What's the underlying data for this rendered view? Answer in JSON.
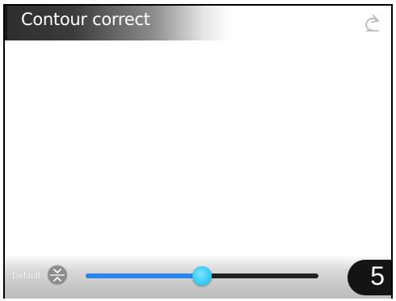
{
  "header": {
    "title": "Contour correct",
    "back_icon": "back-arrow-icon"
  },
  "footer": {
    "default_label": "Default",
    "reset_icon": "up-down-chevrons-icon",
    "slider": {
      "value": 5,
      "fill_fraction": 0.5,
      "fill_color": "#2a86ee",
      "thumb_color": "#38cdf5",
      "track_color": "#222222"
    },
    "value_display": "5"
  }
}
